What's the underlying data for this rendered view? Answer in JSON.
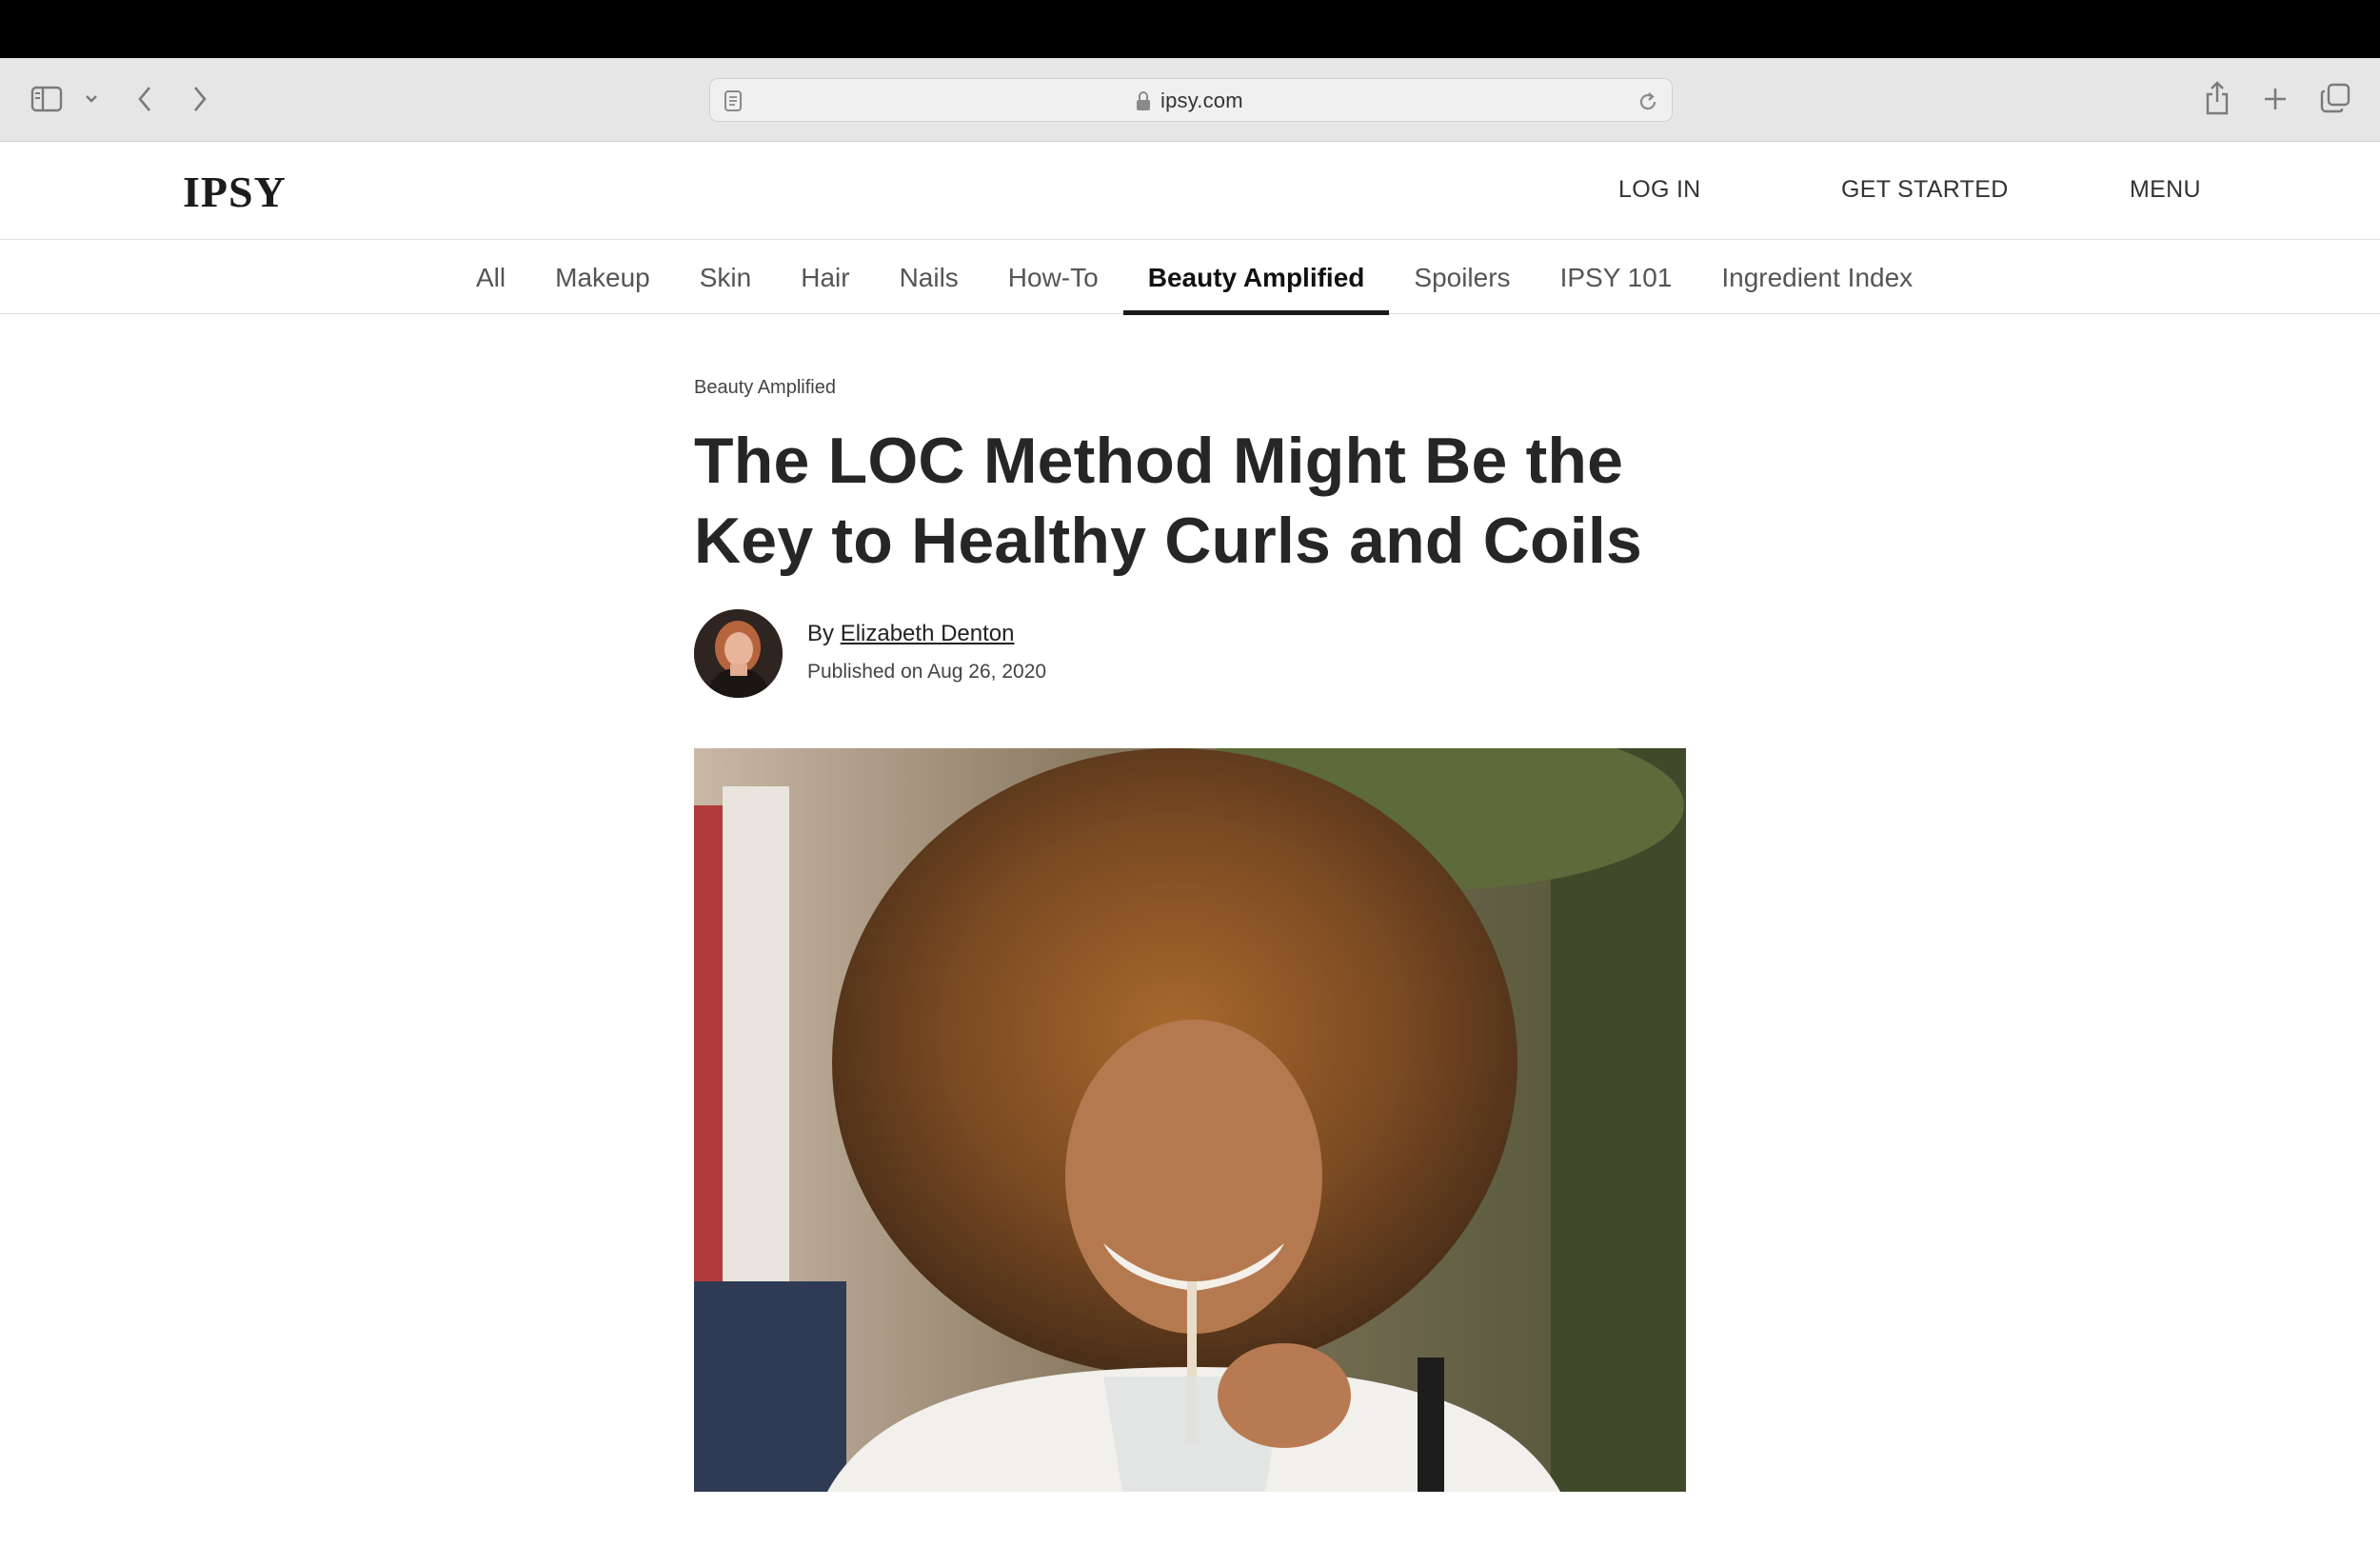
{
  "browser": {
    "url": "ipsy.com",
    "icons": [
      "sidebar-icon",
      "chevron-down-icon",
      "back-icon",
      "forward-icon",
      "reader-icon",
      "lock-icon",
      "reload-icon",
      "share-icon",
      "plus-icon",
      "tabs-icon"
    ]
  },
  "header": {
    "logo": "IPSY",
    "login_label": "LOG IN",
    "get_started_label": "GET STARTED",
    "menu_label": "MENU"
  },
  "categories": [
    {
      "label": "All",
      "active": false
    },
    {
      "label": "Makeup",
      "active": false
    },
    {
      "label": "Skin",
      "active": false
    },
    {
      "label": "Hair",
      "active": false
    },
    {
      "label": "Nails",
      "active": false
    },
    {
      "label": "How-To",
      "active": false
    },
    {
      "label": "Beauty Amplified",
      "active": true
    },
    {
      "label": "Spoilers",
      "active": false
    },
    {
      "label": "IPSY 101",
      "active": false
    },
    {
      "label": "Ingredient Index",
      "active": false
    }
  ],
  "article": {
    "kicker": "Beauty Amplified",
    "title": "The LOC Method Might Be the Key to Healthy Curls and Coils",
    "by_prefix": "By ",
    "author": "Elizabeth Denton",
    "published": "Published on Aug 26, 2020"
  },
  "colors": {
    "text_dark": "#262626",
    "active_underline": "#1a1a1a",
    "toolbar_bg": "#e6e6e7"
  }
}
